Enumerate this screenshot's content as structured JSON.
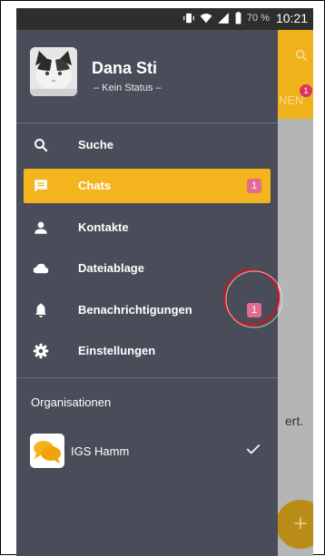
{
  "status_bar": {
    "battery_percent": "70 %",
    "time": "10:21"
  },
  "background_app": {
    "tab_label_fragment": "NEN",
    "tab_badge": "1",
    "content_fragment": "ert.",
    "fab_symbol": "+"
  },
  "drawer": {
    "profile": {
      "name": "Dana Sti",
      "status": "– Kein Status –"
    },
    "menu": [
      {
        "label": "Suche",
        "icon": "search-icon",
        "active": false
      },
      {
        "label": "Chats",
        "icon": "chat-icon",
        "active": true,
        "badge": "1"
      },
      {
        "label": "Kontakte",
        "icon": "contacts-icon",
        "active": false
      },
      {
        "label": "Dateiablage",
        "icon": "cloud-icon",
        "active": false
      },
      {
        "label": "Benachrichtigungen",
        "icon": "bell-icon",
        "active": false,
        "badge": "1"
      },
      {
        "label": "Einstellungen",
        "icon": "gear-icon",
        "active": false
      }
    ],
    "organisations_title": "Organisationen",
    "organisations": [
      {
        "name": "IGS Hamm",
        "selected": true
      }
    ]
  },
  "colors": {
    "accent": "#f4b41e",
    "drawer_bg": "#484d59",
    "badge": "#e26b8f",
    "annotation": "#d0141f"
  }
}
